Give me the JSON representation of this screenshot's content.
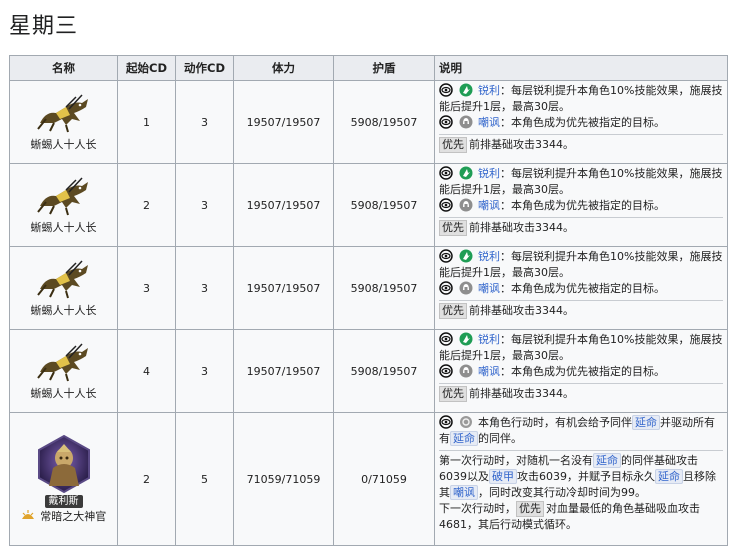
{
  "page": {
    "title": "星期三"
  },
  "table": {
    "headers": {
      "name": "名称",
      "start_cd": "起始CD",
      "action_cd": "动作CD",
      "hp": "体力",
      "shield": "护盾",
      "desc": "说明"
    },
    "rows": [
      {
        "name": "蜥蜴人十人长",
        "start_cd": "1",
        "action_cd": "3",
        "hp": "19507/19507",
        "shield": "5908/19507"
      },
      {
        "name": "蜥蜴人十人长",
        "start_cd": "2",
        "action_cd": "3",
        "hp": "19507/19507",
        "shield": "5908/19507"
      },
      {
        "name": "蜥蜴人十人长",
        "start_cd": "3",
        "action_cd": "3",
        "hp": "19507/19507",
        "shield": "5908/19507"
      },
      {
        "name": "蜥蜴人十人长",
        "start_cd": "4",
        "action_cd": "3",
        "hp": "19507/19507",
        "shield": "5908/19507"
      }
    ],
    "std_desc": {
      "sharp_kw": "锐利",
      "sharp_text": "：每层锐利提升本角色10%技能效果，施展技能后提升1层，最高30层。",
      "taunt_kw": "嘲讽",
      "taunt_text": "：本角色成为优先被指定的目标。",
      "prio_tag": "优先",
      "prio_text": "前排基础攻击3344。"
    },
    "boss": {
      "tag": "戴利斯",
      "title": "常暗之大神官",
      "start_cd": "2",
      "action_cd": "5",
      "hp": "71059/71059",
      "shield": "0/71059",
      "p1_pre": "本角色行动时，有机会给予同伴",
      "p1_kw": "延命",
      "p1_mid": "并驱动所有有",
      "p1_kw2": "延命",
      "p1_end": "的同伴。",
      "p2_a": "第一次行动时，对随机一名没有",
      "p2_kw1": "延命",
      "p2_b": "的同伴基础攻击6039以及",
      "p2_kw2": "破甲",
      "p2_c": "攻击6039，并赋予目标永久",
      "p2_kw3": "延命",
      "p2_d": "且移除其",
      "p2_kw4": "嘲讽",
      "p2_e": "，同时改变其行动冷却时间为99。",
      "p3_a": "下一次行动时，",
      "p3_tag": "优先",
      "p3_b": "对血量最低的角色基础吸血攻击4681，其后行动模式循环。"
    }
  }
}
